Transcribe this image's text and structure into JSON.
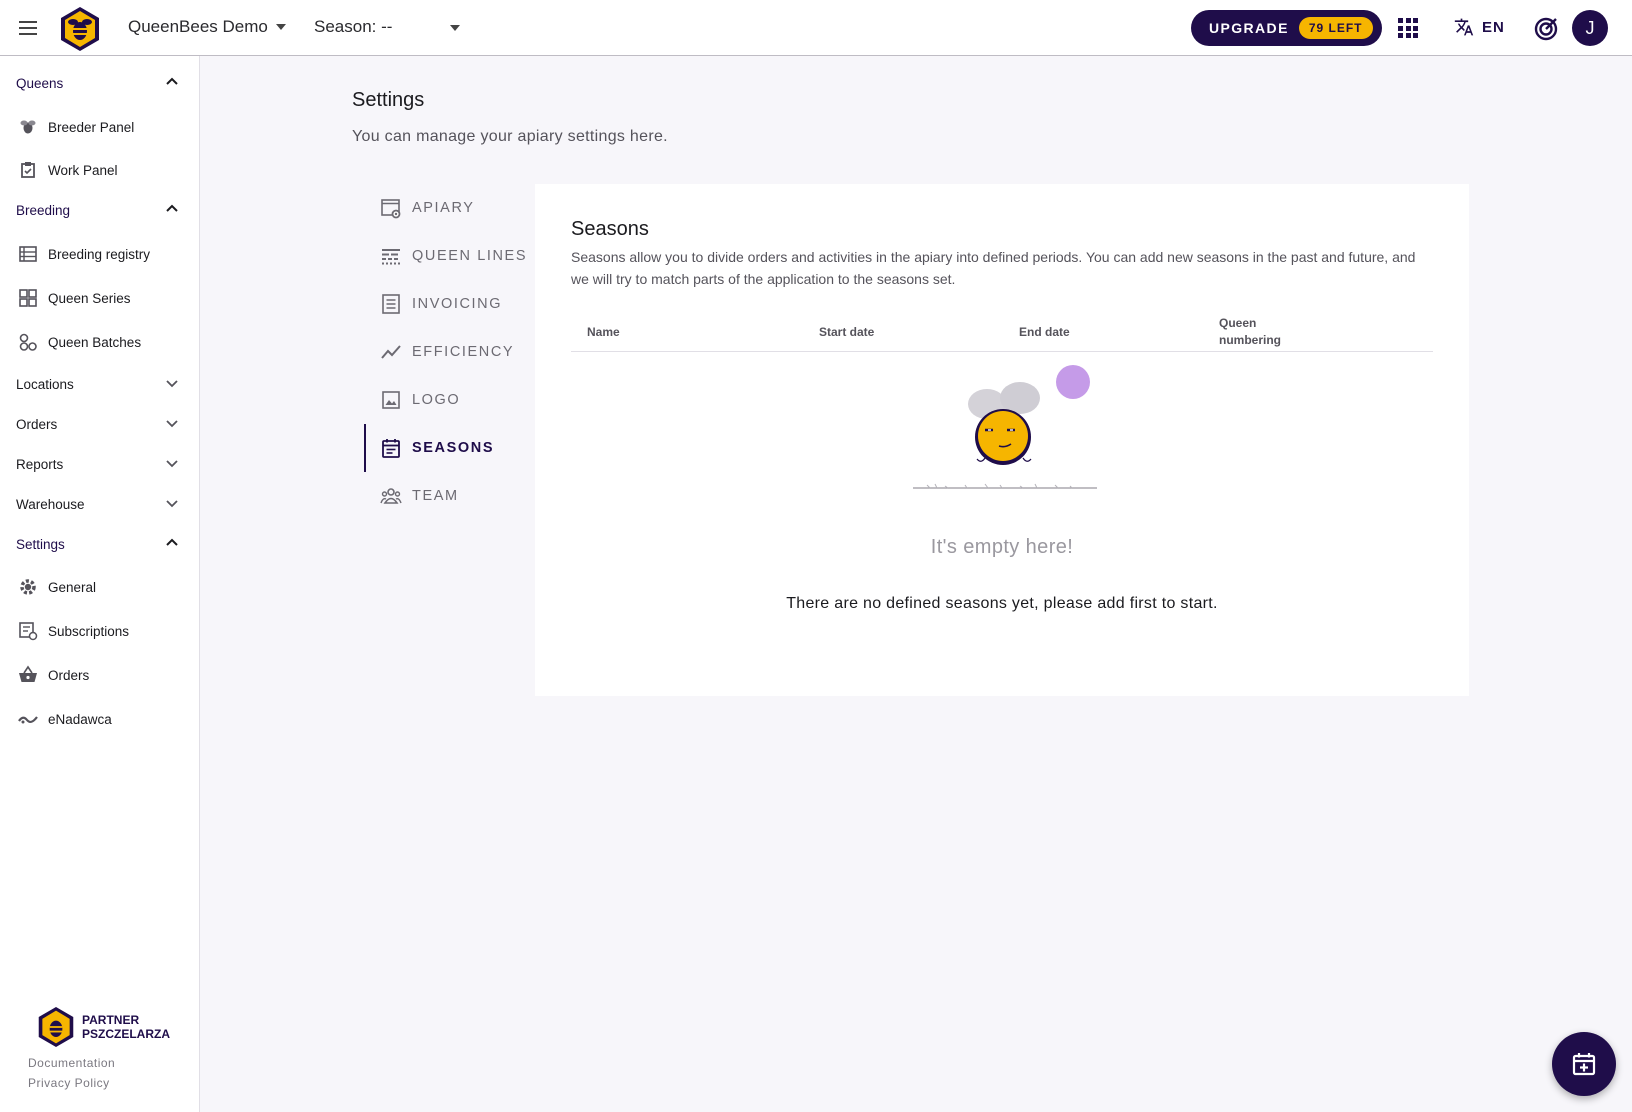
{
  "topbar": {
    "apiary_name": "QueenBees Demo",
    "season_label": "Season: --",
    "upgrade_label": "UPGRADE",
    "upgrade_badge": "79 LEFT",
    "language": "EN",
    "avatar_initial": "J"
  },
  "sidebar": {
    "queens": {
      "label": "Queens",
      "items": [
        "Breeder Panel",
        "Work Panel"
      ]
    },
    "breeding": {
      "label": "Breeding",
      "items": [
        "Breeding registry",
        "Queen Series",
        "Queen Batches"
      ]
    },
    "locations": {
      "label": "Locations"
    },
    "orders": {
      "label": "Orders"
    },
    "reports": {
      "label": "Reports"
    },
    "warehouse": {
      "label": "Warehouse"
    },
    "settings": {
      "label": "Settings",
      "items": [
        "General",
        "Subscriptions",
        "Orders",
        "eNadawca"
      ]
    },
    "partner": {
      "line1": "PARTNER",
      "line2": "PSZCZELARZA"
    },
    "footer": {
      "documentation": "Documentation",
      "privacy": "Privacy Policy"
    }
  },
  "page": {
    "title": "Settings",
    "subtitle": "You can manage your apiary settings here."
  },
  "tabs": [
    {
      "label": "APIARY",
      "icon": "apiary-settings-icon"
    },
    {
      "label": "QUEEN LINES",
      "icon": "queen-lines-icon"
    },
    {
      "label": "INVOICING",
      "icon": "invoice-icon"
    },
    {
      "label": "EFFICIENCY",
      "icon": "trending-up-icon"
    },
    {
      "label": "LOGO",
      "icon": "image-icon"
    },
    {
      "label": "SEASONS",
      "icon": "calendar-icon",
      "active": true
    },
    {
      "label": "TEAM",
      "icon": "people-icon"
    }
  ],
  "seasons": {
    "title": "Seasons",
    "description": "Seasons allow you to divide orders and activities in the apiary into defined periods. You can add new seasons in the past and future, and we will try to match parts of the application to the seasons set.",
    "columns": [
      "Name",
      "Start date",
      "End date",
      "Queen numbering"
    ],
    "empty_title": "It's empty here!",
    "empty_message": "There are no defined seasons yet, please add first to start."
  },
  "colors": {
    "primary": "#1f0d4a",
    "accent": "#f6b500",
    "muted_text": "#55535b"
  }
}
